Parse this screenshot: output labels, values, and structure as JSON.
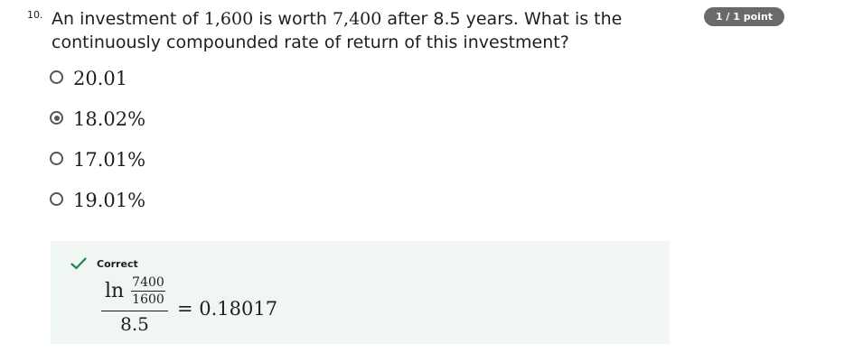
{
  "question": {
    "number": "10.",
    "text_part1": "An investment of ",
    "amount1": "1,600",
    "text_part2": " is worth ",
    "amount2": "7,400",
    "text_part3": " after 8.5 years. What is the continuously compounded rate of return of this investment?",
    "points_badge": "1 / 1 point"
  },
  "options": [
    {
      "label": "20.01",
      "selected": false
    },
    {
      "label": "18.02%",
      "selected": true
    },
    {
      "label": "17.01%",
      "selected": false
    },
    {
      "label": "19.01%",
      "selected": false
    }
  ],
  "feedback": {
    "status": "Correct",
    "icon": "checkmark-icon",
    "status_color": "#1f8354",
    "background": "#f0f6f2",
    "formula": {
      "ln": "ln",
      "inner_numerator": "7400",
      "inner_denominator": "1600",
      "denominator": "8.5",
      "result": "= 0.18017"
    }
  }
}
